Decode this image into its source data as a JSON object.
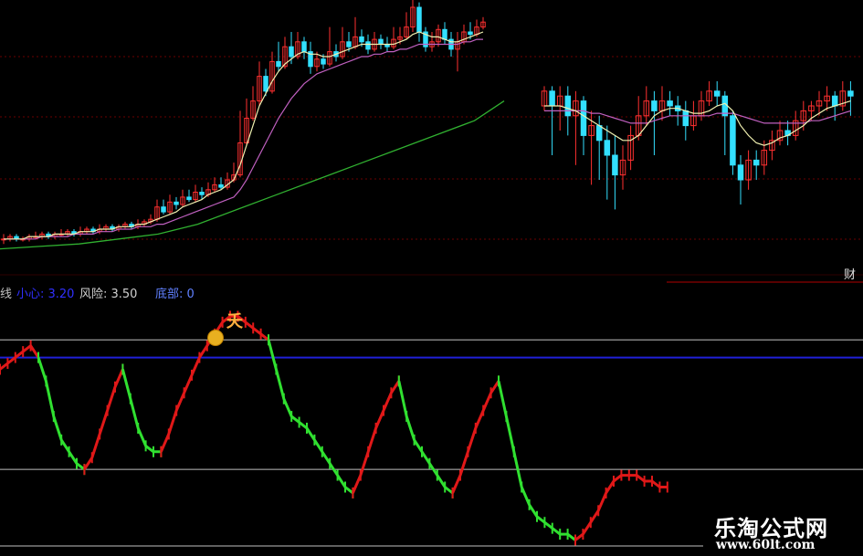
{
  "colors": {
    "up": "#ff3030",
    "down": "#33e0ff",
    "ma_fast": "#f0f0b0",
    "ma_mid": "#c060c0",
    "ma_slow": "#30b030",
    "grid": "#6a0000",
    "osc_up": "#e01818",
    "osc_down": "#30e030",
    "blue_line": "#2020d8",
    "white_line": "#c0c0c0"
  },
  "indicator": {
    "name_partial": "线",
    "caution_label": "小心: 3.20",
    "risk_label": "风险: 3.50",
    "bottom_label": "底部: 0"
  },
  "side_label": "财",
  "marker_glyph": "夭",
  "watermark": {
    "title": "乐淘公式网",
    "url": "www.60lt.com"
  },
  "chart_data": [
    {
      "type": "candlestick",
      "title": "",
      "ylim": [
        0,
        100
      ],
      "candles_left": [
        [
          6,
          6,
          8,
          4
        ],
        [
          6,
          7,
          8,
          5
        ],
        [
          7,
          6,
          8,
          5
        ],
        [
          6,
          6,
          7,
          5
        ],
        [
          6,
          7,
          8,
          5
        ],
        [
          7,
          7,
          9,
          6
        ],
        [
          7,
          8,
          9,
          6
        ],
        [
          8,
          7,
          9,
          6
        ],
        [
          7,
          8,
          9,
          6
        ],
        [
          8,
          8,
          10,
          7
        ],
        [
          8,
          9,
          10,
          7
        ],
        [
          9,
          8,
          10,
          7
        ],
        [
          8,
          9,
          11,
          7
        ],
        [
          9,
          10,
          11,
          8
        ],
        [
          10,
          9,
          11,
          8
        ],
        [
          9,
          10,
          12,
          8
        ],
        [
          10,
          11,
          12,
          9
        ],
        [
          11,
          10,
          12,
          9
        ],
        [
          10,
          11,
          12,
          9
        ],
        [
          11,
          12,
          13,
          10
        ],
        [
          12,
          11,
          13,
          10
        ],
        [
          11,
          12,
          14,
          10
        ],
        [
          12,
          13,
          14,
          11
        ],
        [
          13,
          14,
          16,
          12
        ],
        [
          14,
          19,
          22,
          13
        ],
        [
          19,
          17,
          22,
          16
        ],
        [
          17,
          21,
          24,
          16
        ],
        [
          21,
          20,
          23,
          18
        ],
        [
          20,
          23,
          26,
          19
        ],
        [
          23,
          22,
          26,
          21
        ],
        [
          22,
          25,
          28,
          21
        ],
        [
          25,
          24,
          27,
          22
        ],
        [
          24,
          26,
          29,
          23
        ],
        [
          26,
          28,
          31,
          25
        ],
        [
          28,
          27,
          31,
          26
        ],
        [
          27,
          30,
          33,
          26
        ],
        [
          30,
          32,
          37,
          29
        ],
        [
          32,
          45,
          58,
          31
        ],
        [
          45,
          55,
          63,
          44
        ],
        [
          55,
          62,
          68,
          54
        ],
        [
          62,
          72,
          78,
          60
        ],
        [
          72,
          66,
          75,
          64
        ],
        [
          66,
          78,
          82,
          65
        ],
        [
          78,
          76,
          86,
          74
        ],
        [
          76,
          84,
          88,
          75
        ],
        [
          84,
          80,
          90,
          77
        ],
        [
          80,
          86,
          90,
          79
        ],
        [
          86,
          82,
          88,
          79
        ],
        [
          82,
          76,
          86,
          73
        ],
        [
          76,
          79,
          82,
          74
        ],
        [
          79,
          77,
          81,
          75
        ],
        [
          77,
          82,
          92,
          76
        ],
        [
          82,
          80,
          85,
          78
        ],
        [
          80,
          86,
          92,
          79
        ],
        [
          86,
          84,
          90,
          82
        ],
        [
          84,
          88,
          96,
          83
        ],
        [
          88,
          86,
          91,
          84
        ],
        [
          86,
          83,
          89,
          81
        ],
        [
          83,
          87,
          90,
          82
        ],
        [
          87,
          85,
          89,
          83
        ],
        [
          85,
          84,
          88,
          82
        ],
        [
          84,
          87,
          92,
          83
        ],
        [
          87,
          88,
          92,
          85
        ],
        [
          88,
          92,
          98,
          87
        ],
        [
          92,
          100,
          104,
          90
        ],
        [
          100,
          90,
          102,
          86
        ],
        [
          90,
          84,
          92,
          82
        ],
        [
          84,
          86,
          90,
          82
        ],
        [
          86,
          91,
          93,
          84
        ],
        [
          91,
          87,
          94,
          85
        ],
        [
          87,
          83,
          90,
          80
        ],
        [
          83,
          86,
          90,
          74
        ],
        [
          86,
          90,
          93,
          85
        ],
        [
          90,
          89,
          94,
          87
        ],
        [
          89,
          92,
          95,
          88
        ],
        [
          92,
          94,
          96,
          91
        ]
      ],
      "ma_fast_left": [
        6,
        6,
        6,
        6,
        7,
        7,
        7,
        7,
        8,
        8,
        8,
        8,
        9,
        9,
        9,
        10,
        10,
        10,
        11,
        11,
        11,
        12,
        12,
        13,
        14,
        15,
        16,
        17,
        19,
        20,
        21,
        22,
        24,
        25,
        26,
        28,
        30,
        36,
        44,
        52,
        60,
        65,
        70,
        74,
        77,
        79,
        81,
        82,
        81,
        81,
        80,
        80,
        81,
        82,
        83,
        84,
        85,
        85,
        85,
        85,
        85,
        85,
        86,
        87,
        89,
        90,
        89,
        88,
        88,
        87,
        86,
        86,
        87,
        88,
        89,
        90
      ],
      "ma_mid_left": [
        6,
        6,
        6,
        6,
        6,
        6,
        7,
        7,
        7,
        7,
        7,
        8,
        8,
        8,
        8,
        9,
        9,
        9,
        10,
        10,
        10,
        11,
        11,
        11,
        12,
        12,
        13,
        14,
        15,
        16,
        17,
        18,
        19,
        20,
        21,
        22,
        23,
        26,
        30,
        35,
        40,
        45,
        50,
        55,
        59,
        63,
        66,
        69,
        71,
        73,
        74,
        75,
        76,
        77,
        78,
        79,
        80,
        80,
        81,
        81,
        82,
        82,
        83,
        83,
        84,
        85,
        85,
        85,
        85,
        85,
        85,
        85,
        86,
        86,
        87,
        87
      ],
      "ma_slow_points": [
        [
          0,
          2
        ],
        [
          20,
          3
        ],
        [
          40,
          4
        ],
        [
          60,
          6
        ],
        [
          80,
          8
        ],
        [
          100,
          12
        ],
        [
          120,
          18
        ],
        [
          140,
          24
        ],
        [
          160,
          30
        ],
        [
          180,
          36
        ],
        [
          200,
          42
        ],
        [
          220,
          48
        ],
        [
          240,
          54
        ],
        [
          255,
          62
        ]
      ],
      "candles_right": [
        [
          60,
          66,
          68,
          58
        ],
        [
          66,
          60,
          68,
          40
        ],
        [
          60,
          64,
          68,
          50
        ],
        [
          64,
          56,
          68,
          48
        ],
        [
          56,
          62,
          66,
          36
        ],
        [
          62,
          48,
          64,
          40
        ],
        [
          48,
          52,
          58,
          28
        ],
        [
          52,
          46,
          56,
          30
        ],
        [
          46,
          40,
          52,
          22
        ],
        [
          40,
          32,
          48,
          18
        ],
        [
          32,
          38,
          44,
          26
        ],
        [
          38,
          48,
          52,
          34
        ],
        [
          48,
          56,
          64,
          46
        ],
        [
          56,
          62,
          68,
          52
        ],
        [
          62,
          58,
          66,
          40
        ],
        [
          58,
          62,
          68,
          54
        ],
        [
          62,
          60,
          66,
          56
        ],
        [
          60,
          58,
          64,
          52
        ],
        [
          58,
          52,
          62,
          46
        ],
        [
          52,
          56,
          62,
          50
        ],
        [
          56,
          62,
          66,
          54
        ],
        [
          62,
          66,
          70,
          60
        ],
        [
          66,
          64,
          70,
          60
        ],
        [
          64,
          56,
          66,
          40
        ],
        [
          56,
          36,
          58,
          32
        ],
        [
          36,
          30,
          40,
          20
        ],
        [
          30,
          38,
          42,
          26
        ],
        [
          38,
          36,
          42,
          30
        ],
        [
          36,
          42,
          46,
          32
        ],
        [
          42,
          46,
          50,
          38
        ],
        [
          46,
          50,
          54,
          44
        ],
        [
          50,
          48,
          54,
          44
        ],
        [
          48,
          54,
          58,
          46
        ],
        [
          54,
          58,
          62,
          50
        ],
        [
          58,
          60,
          62,
          54
        ],
        [
          60,
          62,
          66,
          56
        ],
        [
          62,
          64,
          68,
          58
        ],
        [
          64,
          60,
          66,
          54
        ],
        [
          60,
          66,
          70,
          58
        ],
        [
          66,
          64,
          70,
          56
        ]
      ],
      "ma_fast_right": [
        60,
        60,
        60,
        59,
        58,
        56,
        54,
        52,
        50,
        48,
        46,
        46,
        48,
        52,
        56,
        58,
        59,
        59,
        58,
        57,
        57,
        58,
        60,
        61,
        58,
        52,
        48,
        45,
        44,
        45,
        47,
        48,
        50,
        52,
        55,
        57,
        59,
        60,
        61,
        62
      ],
      "ma_mid_right": [
        58,
        58,
        58,
        58,
        58,
        58,
        57,
        57,
        56,
        55,
        54,
        53,
        53,
        53,
        54,
        55,
        56,
        56,
        56,
        56,
        56,
        56,
        57,
        57,
        57,
        56,
        55,
        54,
        53,
        53,
        53,
        53,
        53,
        53,
        54,
        54,
        55,
        56,
        57,
        58
      ]
    },
    {
      "type": "oscillator",
      "title": "",
      "ylim": [
        0,
        4
      ],
      "levels": {
        "top_white": 3.5,
        "blue": 3.2,
        "white_mid": 1.3,
        "bottom_white": 0
      },
      "segments": [
        [
          3.0,
          3.1,
          3.2,
          3.3,
          3.4,
          3.2
        ],
        [
          3.2,
          2.8,
          2.2,
          1.8,
          1.6,
          1.4,
          1.3
        ],
        [
          1.3,
          1.5,
          1.9,
          2.3,
          2.7,
          3.0
        ],
        [
          3.0,
          2.5,
          2.0,
          1.7,
          1.6,
          1.6
        ],
        [
          1.6,
          1.9,
          2.3,
          2.6,
          2.9,
          3.2,
          3.4,
          3.6,
          3.8,
          3.9,
          3.9,
          3.8,
          3.7,
          3.6,
          3.5
        ],
        [
          3.5,
          3.0,
          2.5,
          2.2,
          2.1,
          2.0,
          1.8,
          1.6,
          1.4,
          1.2,
          1.0,
          0.9
        ],
        [
          0.9,
          1.2,
          1.6,
          2.0,
          2.3,
          2.6,
          2.8
        ],
        [
          2.8,
          2.2,
          1.8,
          1.6,
          1.4,
          1.2,
          1.0,
          0.9
        ],
        [
          0.9,
          1.2,
          1.6,
          2.0,
          2.3,
          2.6,
          2.8
        ],
        [
          2.8,
          2.2,
          1.6,
          1.0,
          0.7,
          0.5,
          0.4,
          0.3,
          0.2,
          0.2,
          0.1
        ],
        [
          0.1,
          0.2,
          0.4,
          0.6,
          0.9,
          1.1,
          1.2,
          1.2,
          1.2,
          1.1,
          1.1,
          1.0,
          1.0
        ]
      ]
    }
  ]
}
